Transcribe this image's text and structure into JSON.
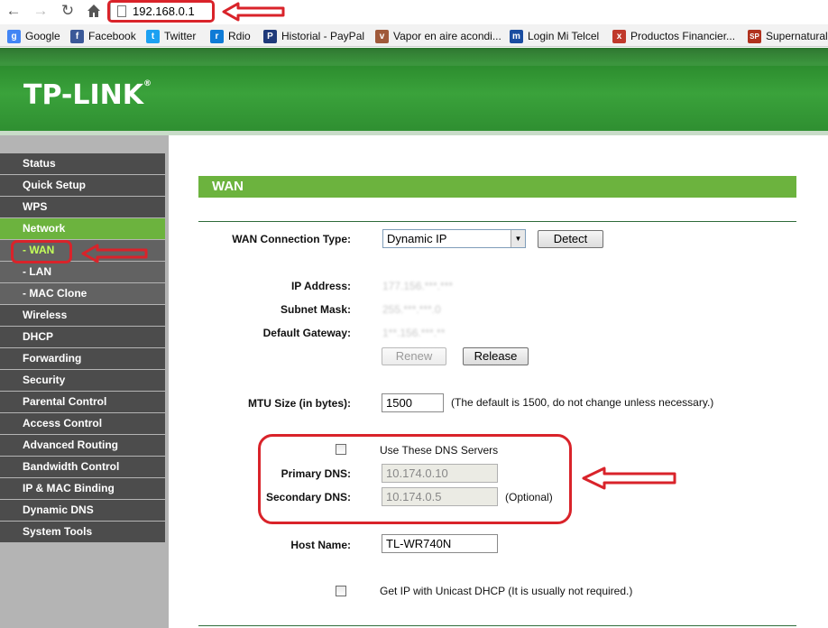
{
  "browser": {
    "address": "192.168.0.1",
    "bookmarks": [
      {
        "label": "Google",
        "icon": "google-icon",
        "color": "#4285f4",
        "glyph": "g"
      },
      {
        "label": "Facebook",
        "icon": "facebook-icon",
        "color": "#3b5998",
        "glyph": "f"
      },
      {
        "label": "Twitter",
        "icon": "twitter-icon",
        "color": "#1da1f2",
        "glyph": "t"
      },
      {
        "label": "Rdio",
        "icon": "rdio-icon",
        "color": "#0f7bd6",
        "glyph": "r"
      },
      {
        "label": "Historial - PayPal",
        "icon": "paypal-icon",
        "color": "#1f3a7a",
        "glyph": "P"
      },
      {
        "label": "Vapor en aire acondi...",
        "icon": "vapor-icon",
        "color": "#a05a3a",
        "glyph": "v"
      },
      {
        "label": "Login Mi Telcel",
        "icon": "telcel-icon",
        "color": "#1a4da0",
        "glyph": "m"
      },
      {
        "label": "Productos Financier...",
        "icon": "financier-icon",
        "color": "#c0392b",
        "glyph": "x"
      },
      {
        "label": "Supernatural",
        "icon": "supernatural-icon",
        "color": "#b0321e",
        "glyph": "SP"
      }
    ]
  },
  "brand": {
    "logo_text": "TP-LINK",
    "logo_mark": "®"
  },
  "sidebar": {
    "items": [
      {
        "label": "Status"
      },
      {
        "label": "Quick Setup"
      },
      {
        "label": "WPS"
      },
      {
        "label": "Network"
      },
      {
        "label": "- WAN"
      },
      {
        "label": "- LAN"
      },
      {
        "label": "- MAC Clone"
      },
      {
        "label": "Wireless"
      },
      {
        "label": "DHCP"
      },
      {
        "label": "Forwarding"
      },
      {
        "label": "Security"
      },
      {
        "label": "Parental Control"
      },
      {
        "label": "Access Control"
      },
      {
        "label": "Advanced Routing"
      },
      {
        "label": "Bandwidth Control"
      },
      {
        "label": "IP & MAC Binding"
      },
      {
        "label": "Dynamic DNS"
      },
      {
        "label": "System Tools"
      }
    ]
  },
  "wan": {
    "section_title": "WAN",
    "connection_type_label": "WAN Connection Type:",
    "connection_type_value": "Dynamic IP",
    "detect_button": "Detect",
    "ip_address_label": "IP Address:",
    "ip_address_value": "177.156.***.***",
    "subnet_mask_label": "Subnet Mask:",
    "subnet_mask_value": "255.***.***.0",
    "default_gateway_label": "Default Gateway:",
    "default_gateway_value": "1**.156.***.**",
    "renew_button": "Renew",
    "release_button": "Release",
    "mtu_label": "MTU Size (in bytes):",
    "mtu_value": "1500",
    "mtu_note": "(The default is 1500, do not change unless necessary.)",
    "use_dns_label": "Use These DNS Servers",
    "primary_dns_label": "Primary DNS:",
    "primary_dns_value": "10.174.0.10",
    "secondary_dns_label": "Secondary DNS:",
    "secondary_dns_value": "10.174.0.5",
    "optional_label": "(Optional)",
    "host_name_label": "Host Name:",
    "host_name_value": "TL-WR740N",
    "unicast_label": "Get IP with Unicast DHCP (It is usually not required.)"
  },
  "colors": {
    "accent_green": "#6cb33e",
    "menu_dark": "#4c4c4c",
    "annotation_red": "#d9232a"
  }
}
